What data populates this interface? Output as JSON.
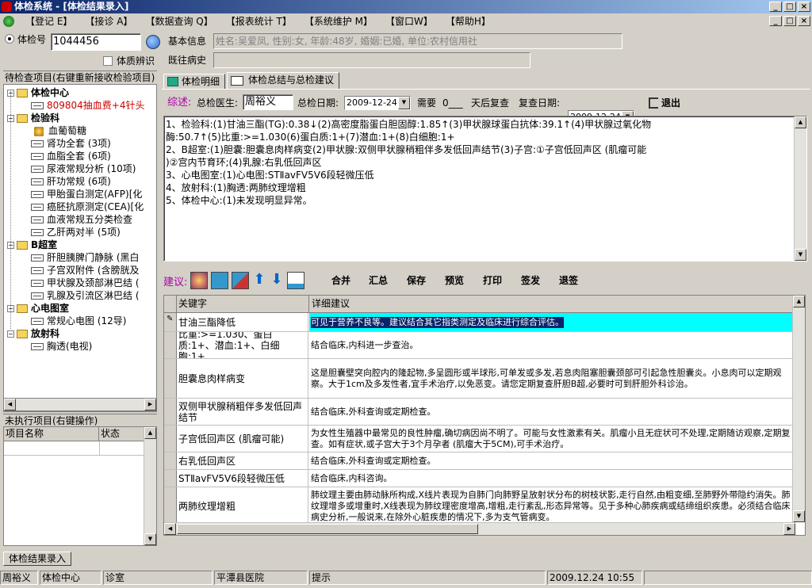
{
  "window": {
    "title": "体检系统 - [体检结果录入]"
  },
  "menu": [
    {
      "label": "【登记 E】"
    },
    {
      "label": "【接诊 A】"
    },
    {
      "label": "【数据查询 Q】"
    },
    {
      "label": "【报表统计 T】"
    },
    {
      "label": "【系统维护 M】"
    },
    {
      "label": "【窗口W】"
    },
    {
      "label": "【帮助H】"
    }
  ],
  "left": {
    "exam_no_label": "体检号",
    "exam_no_value": "1044456",
    "constitution_label": "体质辨识",
    "pending_header": "待检查项目(右键重新接收检验项目)",
    "unexec_header": "未执行项目(右键操作)",
    "unexec_cols": [
      "项目名称",
      "状态"
    ]
  },
  "tree": [
    {
      "label": "体检中心",
      "level": 0,
      "type": "group"
    },
    {
      "label": "809804抽血费+4针头",
      "level": 1,
      "type": "red"
    },
    {
      "label": "检验科",
      "level": 0,
      "type": "group"
    },
    {
      "label": "血葡萄糖",
      "level": 1,
      "type": "special"
    },
    {
      "label": "肾功全套 (3项)",
      "level": 1,
      "type": "item"
    },
    {
      "label": "血脂全套 (6项)",
      "level": 1,
      "type": "item"
    },
    {
      "label": "尿液常规分析 (10项)",
      "level": 1,
      "type": "item"
    },
    {
      "label": "肝功常规 (6项)",
      "level": 1,
      "type": "item"
    },
    {
      "label": "甲胎蛋白测定(AFP)[化",
      "level": 1,
      "type": "item"
    },
    {
      "label": "癌胚抗原测定(CEA)[化",
      "level": 1,
      "type": "item"
    },
    {
      "label": "血液常规五分类检查",
      "level": 1,
      "type": "item"
    },
    {
      "label": "乙肝两对半 (5项)",
      "level": 1,
      "type": "item"
    },
    {
      "label": "B超室",
      "level": 0,
      "type": "group"
    },
    {
      "label": "肝胆胰脾门静脉 (黑白",
      "level": 1,
      "type": "item"
    },
    {
      "label": "子宫双附件 (含膀胱及",
      "level": 1,
      "type": "item"
    },
    {
      "label": "甲状腺及颈部淋巴结 (",
      "level": 1,
      "type": "item"
    },
    {
      "label": "乳腺及引流区淋巴结 (",
      "level": 1,
      "type": "item"
    },
    {
      "label": "心电图室",
      "level": 0,
      "type": "group"
    },
    {
      "label": "常规心电图 (12导)",
      "level": 1,
      "type": "item"
    },
    {
      "label": "放射科",
      "level": 0,
      "type": "group"
    },
    {
      "label": "胸透(电视)",
      "level": 1,
      "type": "item"
    }
  ],
  "info": {
    "basic_label": "基本信息",
    "basic_value": "姓名:吴爱凤, 性别:女, 年龄:48岁, 婚姻:已婚, 单位:农村信用社",
    "history_label": "既往病史",
    "history_value": ""
  },
  "tabs": [
    {
      "label": "体检明细"
    },
    {
      "label": "体检总结与总检建议"
    }
  ],
  "summary": {
    "summary_label": "综述:",
    "doctor_label": "总检医生:",
    "doctor_value": "周裕义",
    "date_label": "总检日期:",
    "date_value": "2009-12-24",
    "need_label": "需要",
    "need_value": "0___",
    "days_label": "天后复查",
    "recheck_label": "复查日期:",
    "recheck_value": "2009-12-24",
    "exit_label": "退出",
    "text_lines": [
      "1、检验科:(1)甘油三酯(TG):0.38↓(2)高密度脂蛋白胆固醇:1.85↑(3)甲状腺球蛋白抗体:39.1↑(4)甲状腺过氧化物",
      "酶:50.7↑(5)比重:>=1.030(6)蛋白质:1+(7)潜血:1+(8)白细胞:1+",
      "2、B超室:(1)胆囊:胆囊息肉样病变(2)甲状腺:双侧甲状腺稍粗伴多发低回声结节(3)子宫:①子宫低回声区 (肌瘤可能",
      ")②宫内节育环;(4)乳腺:右乳低回声区",
      "3、心电图室:(1)心电图:STⅡavFV5V6段轻微压低",
      "4、放射科:(1)胸透:两肺纹理增粗",
      "5、体检中心:(1)未发现明显异常。"
    ]
  },
  "advice": {
    "label": "建议:",
    "buttons": [
      "合并",
      "汇总",
      "保存",
      "预览",
      "打印",
      "签发",
      "退签"
    ],
    "col_keyword": "关键字",
    "col_detail": "详细建议",
    "rows": [
      {
        "keyword": "甘油三酯降低",
        "detail": "可见于营养不良等。建议结合其它指类测定及临床进行综合评估。"
      },
      {
        "keyword": "比重:>=1.030、蛋白质:1+、潜血:1+、白细胞:1+",
        "detail": "结合临床,内科进一步查治。"
      },
      {
        "keyword": "胆囊息肉样病变",
        "detail": "这是胆囊壁突向腔内的隆起物,多呈圆形或半球形,可单发或多发,若息肉阻塞胆囊颈部可引起急性胆囊炎。小息肉可以定期观察。大于1cm及多发性者,宜手术治疗,以免恶变。请您定期复查肝胆B超,必要时可到肝胆外科诊治。"
      },
      {
        "keyword": "双侧甲状腺稍粗伴多发低回声结节",
        "detail": "结合临床,外科查询或定期检查。"
      },
      {
        "keyword": "子宫低回声区 (肌瘤可能)",
        "detail": "为女性生殖器中最常见的良性肿瘤,确切病因尚不明了。可能与女性激素有关。肌瘤小且无症状可不处理,定期随访观察,定期复查。如有症状,或子宫大于3个月孕者 (肌瘤大于5CM),可手术治疗。"
      },
      {
        "keyword": "右乳低回声区",
        "detail": "结合临床,外科查询或定期检查。"
      },
      {
        "keyword": "STⅡavFV5V6段轻微压低",
        "detail": "结合临床,内科咨询。"
      },
      {
        "keyword": "两肺纹理增粗",
        "detail": "肺纹理主要由肺动脉所构成,X线片表现为自肺门向肺野呈放射状分布的树枝状影,走行自然,由粗变细,至肺野外带隐约消失。肺纹理增多或增重时,X线表现为肺纹理密度增高,增粗,走行紊乱,形态异常等。见于多种心肺疾病或结缔组织疾患。必须结合临床病史分析,一般说来,在除外心脏疾患的情况下,多为支气管病变。"
      }
    ]
  },
  "bottom_tab": "体检结果录入",
  "status": [
    "周裕义",
    "体检中心",
    "诊室",
    "平潭县医院",
    "提示",
    "2009.12.24  10:55"
  ]
}
